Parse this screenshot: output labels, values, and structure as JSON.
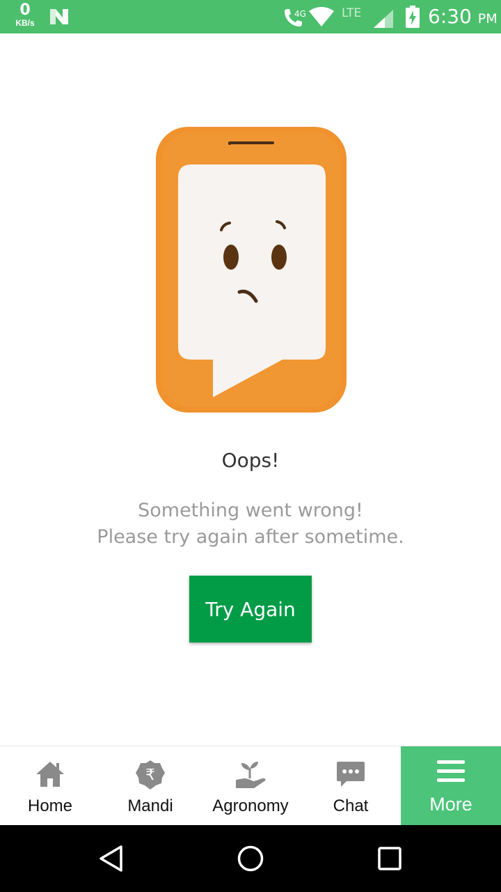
{
  "status_bar": {
    "net_speed_value": "0",
    "net_speed_unit": "KB/s",
    "network_label": "4G",
    "lte_label": "LTE",
    "time": "6:30",
    "ampm": "PM",
    "background_color": "#4cbf6d"
  },
  "error": {
    "title": "Oops!",
    "message_line1": "Something went wrong!",
    "message_line2": "Please try again after sometime.",
    "button_label": "Try Again",
    "button_color": "#029c47"
  },
  "bottom_nav": {
    "items": [
      {
        "label": "Home",
        "icon": "home-icon"
      },
      {
        "label": "Mandi",
        "icon": "rupee-icon"
      },
      {
        "label": "Agronomy",
        "icon": "plant-hand-icon"
      },
      {
        "label": "Chat",
        "icon": "chat-icon"
      },
      {
        "label": "More",
        "icon": "menu-icon",
        "active": true
      }
    ],
    "active_color": "#4cc47a"
  },
  "system_nav": {
    "icons": [
      "back-icon",
      "home-circle-icon",
      "recents-icon"
    ]
  }
}
